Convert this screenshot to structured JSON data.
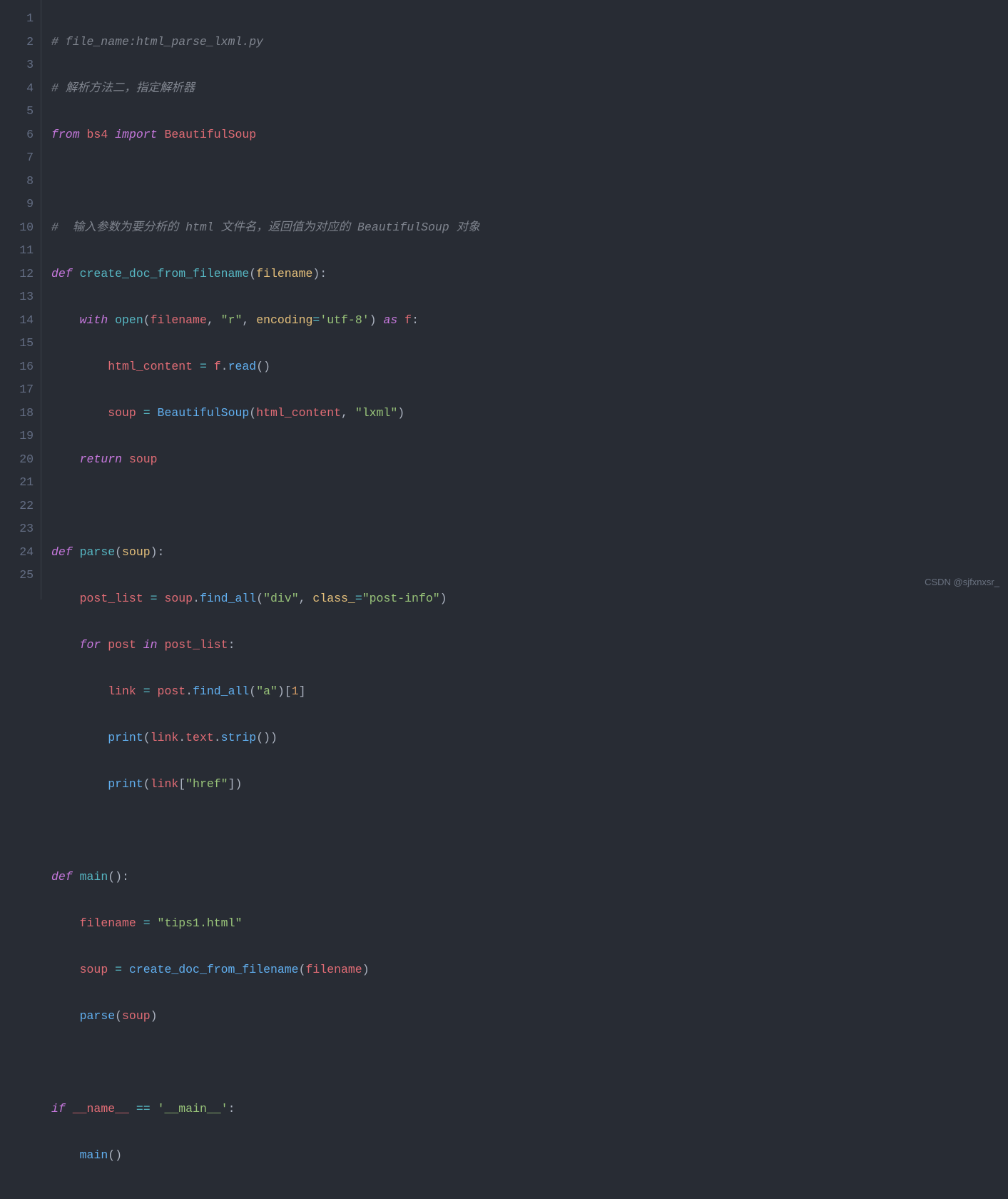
{
  "watermark": "CSDN @sjfxnxsr_",
  "lines": [
    "1",
    "2",
    "3",
    "4",
    "5",
    "6",
    "7",
    "8",
    "9",
    "10",
    "11",
    "12",
    "13",
    "14",
    "15",
    "16",
    "17",
    "18",
    "19",
    "20",
    "21",
    "22",
    "23",
    "24",
    "25"
  ],
  "code": {
    "l1": "# file_name:html_parse_lxml.py",
    "l2": "# 解析方法二，指定解析器",
    "l3": {
      "from": "from",
      "mod": "bs4",
      "import": "import",
      "name": "BeautifulSoup"
    },
    "l5": "#  输入参数为要分析的 html 文件名，返回值为对应的 BeautifulSoup 对象",
    "l6": {
      "def": "def",
      "name": "create_doc_from_filename",
      "p": "filename"
    },
    "l7": {
      "with": "with",
      "open": "open",
      "p": "filename",
      "r": "\"r\"",
      "enc": "encoding",
      "encv": "'utf-8'",
      "as": "as",
      "f": "f"
    },
    "l8": {
      "var": "html_content",
      "f": "f",
      "read": "read"
    },
    "l9": {
      "var": "soup",
      "cls": "BeautifulSoup",
      "a": "html_content",
      "b": "\"lxml\""
    },
    "l10": {
      "ret": "return",
      "v": "soup"
    },
    "l12": {
      "def": "def",
      "name": "parse",
      "p": "soup"
    },
    "l13": {
      "var": "post_list",
      "obj": "soup",
      "fn": "find_all",
      "a": "\"div\"",
      "kw": "class_",
      "b": "\"post-info\""
    },
    "l14": {
      "for": "for",
      "v": "post",
      "in": "in",
      "it": "post_list"
    },
    "l15": {
      "var": "link",
      "obj": "post",
      "fn": "find_all",
      "a": "\"a\"",
      "idx": "1"
    },
    "l16": {
      "print": "print",
      "obj": "link",
      "attr": "text",
      "fn": "strip"
    },
    "l17": {
      "print": "print",
      "obj": "link",
      "key": "\"href\""
    },
    "l19": {
      "def": "def",
      "name": "main"
    },
    "l20": {
      "var": "filename",
      "val": "\"tips1.html\""
    },
    "l21": {
      "var": "soup",
      "fn": "create_doc_from_filename",
      "a": "filename"
    },
    "l22": {
      "fn": "parse",
      "a": "soup"
    },
    "l24": {
      "if": "if",
      "name": "__name__",
      "eq": "==",
      "val": "'__main__'"
    },
    "l25": {
      "fn": "main"
    }
  }
}
